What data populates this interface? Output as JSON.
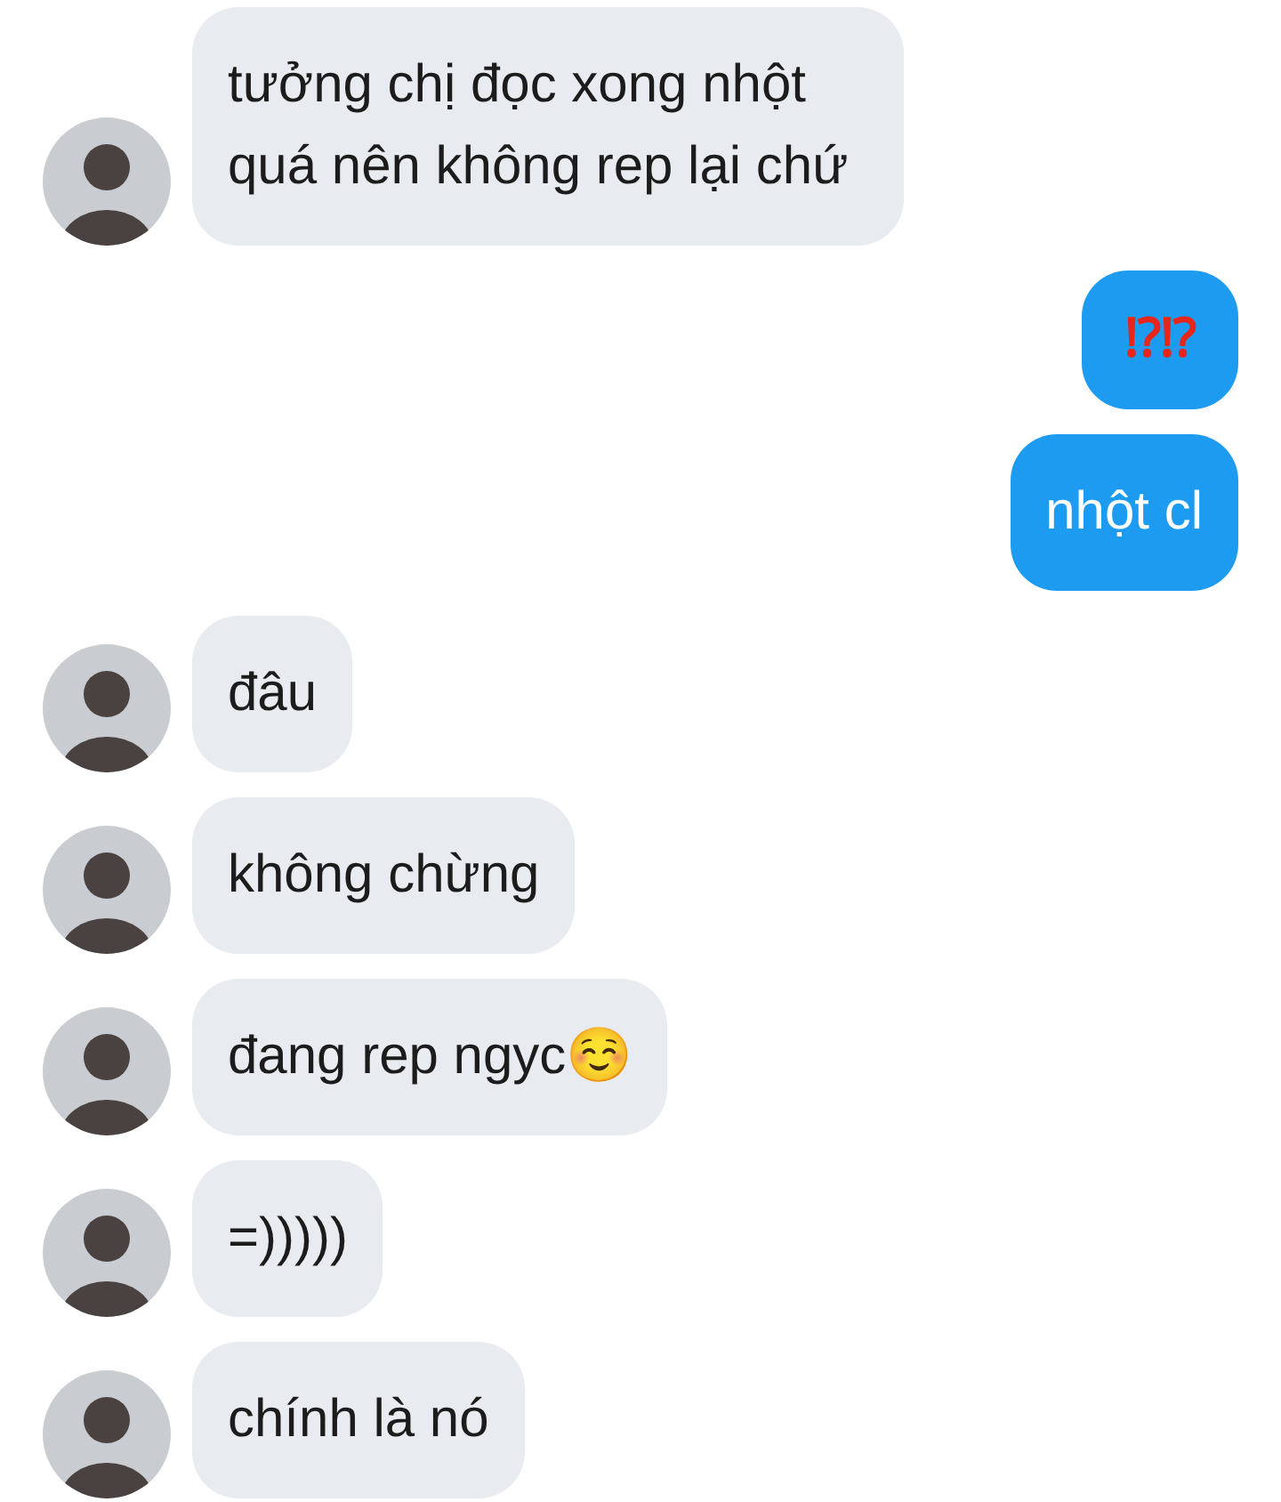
{
  "messages": [
    {
      "outgoing": false,
      "kind": "text",
      "text": "tưởng chị đọc xong nhột quá nên không rep lại chứ"
    },
    {
      "outgoing": true,
      "kind": "emoji",
      "text": "⁉⁉"
    },
    {
      "outgoing": true,
      "kind": "text",
      "text": "nhột cl"
    },
    {
      "outgoing": false,
      "kind": "text",
      "text": "đâu"
    },
    {
      "outgoing": false,
      "kind": "text",
      "text": "không chừng"
    },
    {
      "outgoing": false,
      "kind": "text",
      "text": "đang rep ngyc☺️"
    },
    {
      "outgoing": false,
      "kind": "text",
      "text": "=)))))"
    },
    {
      "outgoing": false,
      "kind": "text",
      "text": "chính là nó"
    }
  ]
}
